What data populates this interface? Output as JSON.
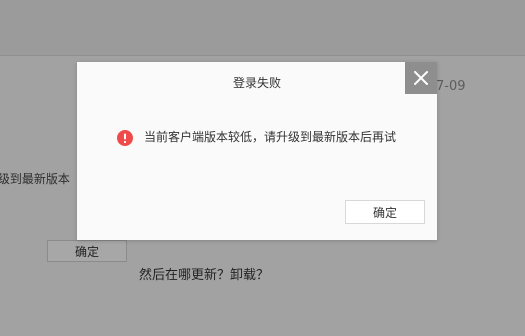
{
  "background": {
    "date_fragment": "7-09",
    "upgrade_fragment": "·级到最新版本",
    "ok_button_label": "确定",
    "question_text": "然后在哪更新？卸载？"
  },
  "dialog": {
    "title": "登录失败",
    "message": "当前客户端版本较低，请升级到最新版本后再试",
    "confirm_label": "确定",
    "icons": {
      "close": "close-icon",
      "status": "error-icon"
    }
  },
  "colors": {
    "error": "#f04b4b",
    "overlay": "#a2a2a2",
    "dialog_bg": "#fafafa",
    "close_bg": "#8e8e8e"
  }
}
